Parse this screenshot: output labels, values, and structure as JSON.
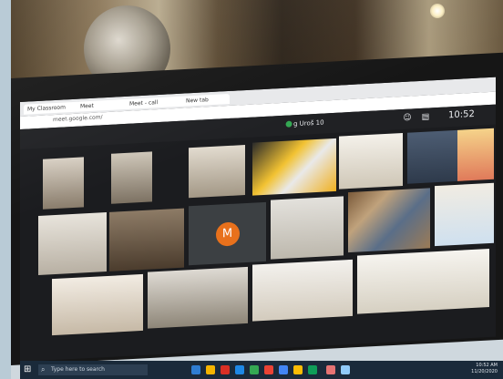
{
  "browser": {
    "tabs": [
      "My Classroom",
      "Meet",
      "Meet - call",
      "New tab"
    ],
    "address": "meet.google.com/"
  },
  "meeting": {
    "participant_label": "g Uroš 10",
    "time": "10:52",
    "avatar_letter": "M"
  },
  "taskbar": {
    "search_placeholder": "Type here to search",
    "clock_time": "10:52 AM",
    "clock_date": "11/20/2020"
  },
  "icons": [
    "windows-start-icon",
    "search-icon",
    "people-icon",
    "chat-icon"
  ]
}
